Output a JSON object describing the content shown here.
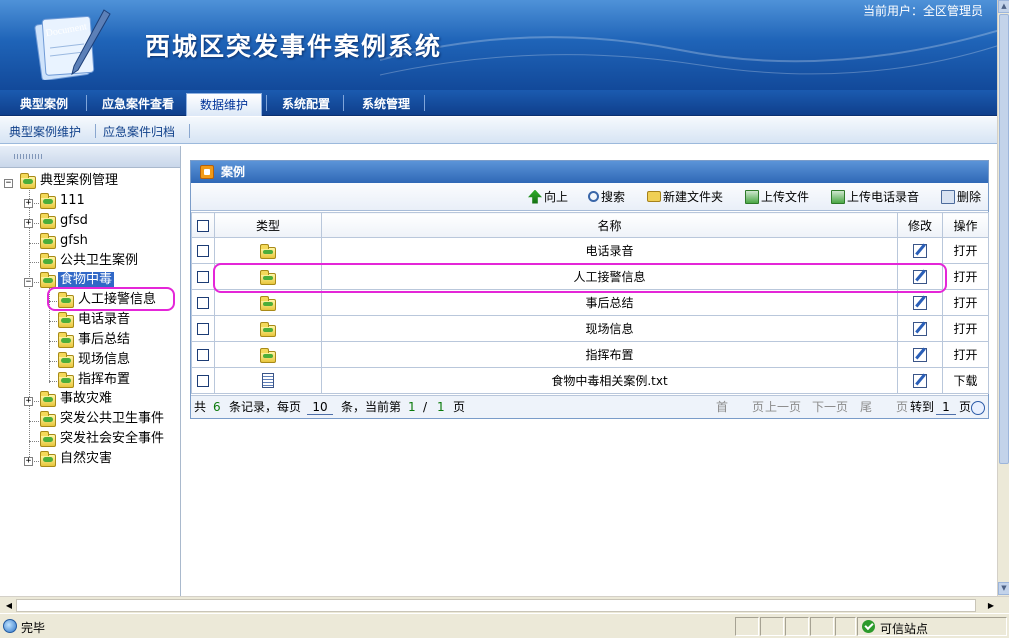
{
  "header": {
    "system_title": "西城区突发事件案例系统",
    "current_user": "当前用户：全区管理员",
    "logo_text": "Document"
  },
  "nav": {
    "tabs": [
      {
        "label": "典型案例"
      },
      {
        "label": "应急案件查看"
      },
      {
        "label": "数据维护"
      },
      {
        "label": "系统配置"
      },
      {
        "label": "系统管理"
      }
    ],
    "active_tab": "数据维护"
  },
  "subnav": {
    "items": [
      {
        "label": "典型案例维护"
      },
      {
        "label": "应急案件归档"
      }
    ]
  },
  "tree": {
    "root": "典型案例管理",
    "nodes": [
      {
        "label": "111"
      },
      {
        "label": "gfsd"
      },
      {
        "label": "gfsh"
      },
      {
        "label": "公共卫生案例"
      },
      {
        "label": "食物中毒"
      },
      {
        "label": "人工接警信息"
      },
      {
        "label": "电话录音"
      },
      {
        "label": "事后总结"
      },
      {
        "label": "现场信息"
      },
      {
        "label": "指挥布置"
      },
      {
        "label": "事故灾难"
      },
      {
        "label": "突发公共卫生事件"
      },
      {
        "label": "突发社会安全事件"
      },
      {
        "label": "自然灾害"
      }
    ]
  },
  "panel": {
    "title": "案例",
    "toolbar": {
      "up": "向上",
      "search": "搜索",
      "new_folder": "新建文件夹",
      "upload_file": "上传文件",
      "upload_recording": "上传电话录音",
      "delete": "删除"
    },
    "columns": {
      "type": "类型",
      "name": "名称",
      "edit": "修改",
      "action": "操作"
    },
    "rows": [
      {
        "type": "folder",
        "name": "电话录音",
        "action": "打开"
      },
      {
        "type": "folder",
        "name": "人工接警信息",
        "action": "打开"
      },
      {
        "type": "folder",
        "name": "事后总结",
        "action": "打开"
      },
      {
        "type": "folder",
        "name": "现场信息",
        "action": "打开"
      },
      {
        "type": "folder",
        "name": "指挥布置",
        "action": "打开"
      },
      {
        "type": "file",
        "name": "食物中毒相关案例.txt",
        "action": "下载"
      }
    ]
  },
  "pager": {
    "total_prefix": "共",
    "total": "6",
    "records_per_page_label": "条记录，每页",
    "page_size": "10",
    "current_page_label": "条，当前第",
    "current_page": "1",
    "slash": "/",
    "total_pages": "1",
    "page_unit": "页",
    "first": "首　　页",
    "prev": "上一页",
    "next": "下一页",
    "last": "尾　　页",
    "goto_label": "转到",
    "goto_value": "1",
    "goto_unit": "页"
  },
  "statusbar": {
    "status_text": "完毕",
    "zone_text": "可信站点"
  },
  "colors": {
    "header_blue": "#1f64b8",
    "highlight_magenta": "#e426d8",
    "selection_blue": "#3168c7"
  }
}
